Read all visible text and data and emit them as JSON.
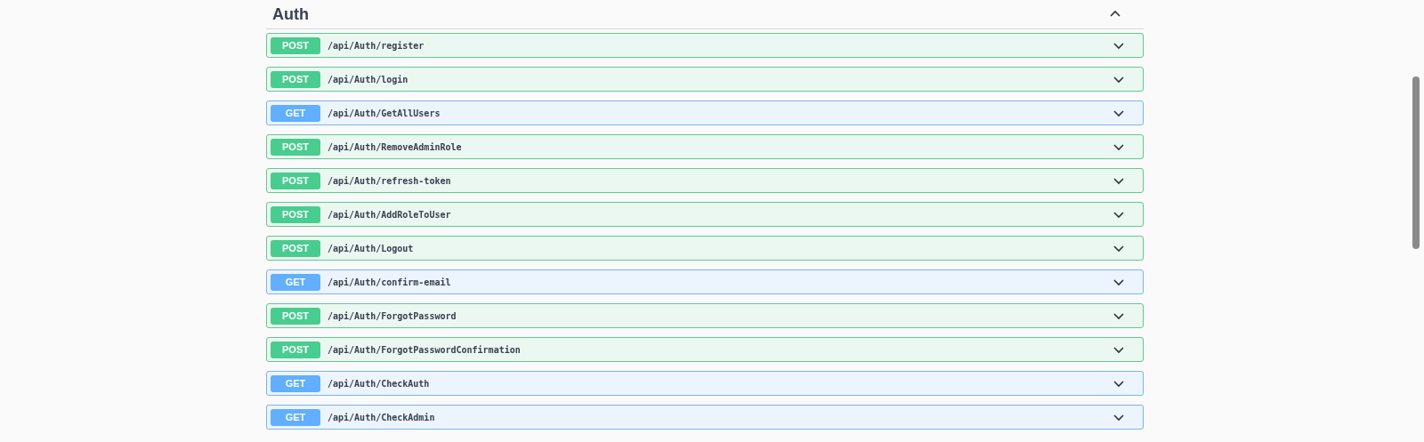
{
  "section": {
    "title": "Auth",
    "expanded": true
  },
  "operations": [
    {
      "method": "POST",
      "path": "/api/Auth/register",
      "expanded": false
    },
    {
      "method": "POST",
      "path": "/api/Auth/login",
      "expanded": false
    },
    {
      "method": "GET",
      "path": "/api/Auth/GetAllUsers",
      "expanded": false
    },
    {
      "method": "POST",
      "path": "/api/Auth/RemoveAdminRole",
      "expanded": false
    },
    {
      "method": "POST",
      "path": "/api/Auth/refresh-token",
      "expanded": false
    },
    {
      "method": "POST",
      "path": "/api/Auth/AddRoleToUser",
      "expanded": false
    },
    {
      "method": "POST",
      "path": "/api/Auth/Logout",
      "expanded": false
    },
    {
      "method": "GET",
      "path": "/api/Auth/confirm-email",
      "expanded": false
    },
    {
      "method": "POST",
      "path": "/api/Auth/ForgotPassword",
      "expanded": false
    },
    {
      "method": "POST",
      "path": "/api/Auth/ForgotPasswordConfirmation",
      "expanded": false
    },
    {
      "method": "GET",
      "path": "/api/Auth/CheckAuth",
      "expanded": false
    },
    {
      "method": "GET",
      "path": "/api/Auth/CheckAdmin",
      "expanded": false
    }
  ]
}
